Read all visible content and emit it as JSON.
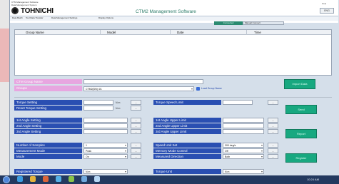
{
  "brand": {
    "logo_text": "TOHNICHI",
    "titlebar_lines": [
      "CTM Management Software",
      "Data Management System"
    ]
  },
  "window": {
    "title": "CTM2 Management Software",
    "right_controls": [
      "ENG",
      "Help"
    ]
  },
  "menu": {
    "items": [
      "Data Batch",
      "Tool Data Transfer",
      "Data Management Settings",
      "Display Options"
    ]
  },
  "tabs": {
    "connect": "Connected",
    "comm_label": "Manual Connect"
  },
  "table": {
    "columns": [
      "Group Name",
      "Model",
      "Date",
      "Time"
    ]
  },
  "group_section": {
    "label1": "CTM Group Name",
    "label2": "Groups",
    "select_value": "CTM2(DN) 4/1",
    "link_text": "Load Group Name",
    "button": "Import Data"
  },
  "torque_section": {
    "rows": [
      {
        "label": "Torque Setting"
      },
      {
        "label": "Reset Torque Setting"
      }
    ],
    "right_label": "Torque Speed Limit",
    "button": "Send"
  },
  "angle_section": {
    "rows": [
      {
        "label": "1st Angle Setting"
      },
      {
        "label": "2nd Angle Setting"
      },
      {
        "label": "3rd Angle Setting"
      }
    ],
    "right_rows": [
      {
        "label": "1st Angle Upper Limit"
      },
      {
        "label": "2nd Angle Upper Limit"
      },
      {
        "label": "3rd Angle Upper Limit"
      }
    ],
    "button": "Report"
  },
  "param_section": {
    "rows": [
      {
        "label": "Number of Samples",
        "value": "1"
      },
      {
        "label": "Measurement Mode",
        "value": "Peak"
      },
      {
        "label": "Mode",
        "value": "On"
      }
    ],
    "right_rows": [
      {
        "label": "Speed Unit Set",
        "value": "300 deg/s"
      },
      {
        "label": "Memory Mode Control",
        "value": "Off"
      },
      {
        "label": "Measured Direction",
        "value": "Both"
      }
    ],
    "button": "Register"
  },
  "bottom_section": {
    "label": "Registered Torque",
    "value": "N.m",
    "right_label": "Torque Unit",
    "right_value": "N.m"
  },
  "side_buttons": {
    "button_label": "...",
    "unit_label": "N.m"
  },
  "taskbar": {
    "clock": "10:24 AM"
  },
  "colors": {
    "label_bg": "#2a4fb2",
    "green": "#18a880",
    "pink": "#e7a6e0",
    "page_bg": "#c9d5e4"
  },
  "icons": [
    "tohnichi-logo-icon",
    "start-icon",
    "ie-icon",
    "folder-icon",
    "media-icon",
    "app-icon"
  ]
}
